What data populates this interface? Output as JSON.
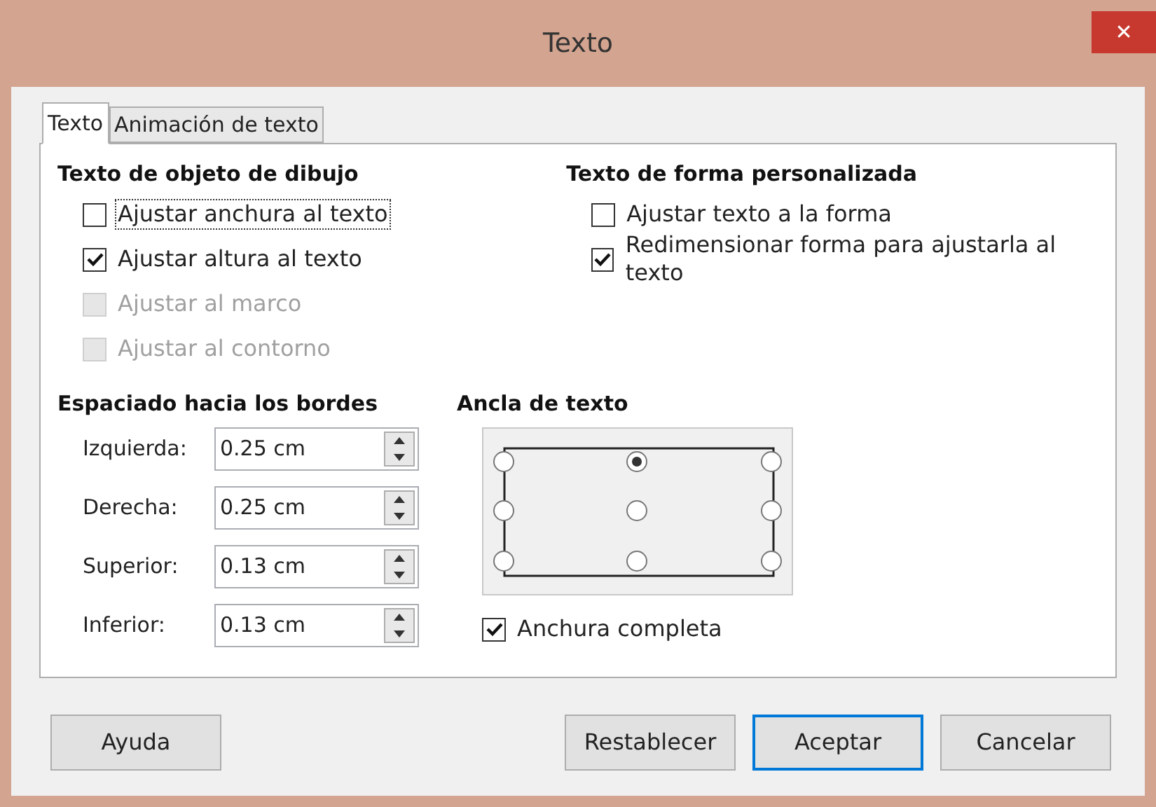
{
  "window": {
    "title": "Texto",
    "close": "✕"
  },
  "tabs": [
    {
      "label": "Texto",
      "selected": true
    },
    {
      "label": "Animación de texto",
      "selected": false
    }
  ],
  "drawing_object_text": {
    "heading": "Texto de objeto de dibujo",
    "options": [
      {
        "label": "Ajustar anchura al texto",
        "checked": false,
        "disabled": false,
        "focused": true
      },
      {
        "label": "Ajustar altura al texto",
        "checked": true,
        "disabled": false,
        "focused": false
      },
      {
        "label": "Ajustar al marco",
        "checked": false,
        "disabled": true,
        "focused": false
      },
      {
        "label": "Ajustar al contorno",
        "checked": false,
        "disabled": true,
        "focused": false
      }
    ]
  },
  "custom_shape_text": {
    "heading": "Texto de forma personalizada",
    "options": [
      {
        "label": "Ajustar texto a la forma",
        "checked": false,
        "disabled": false,
        "focused": false
      },
      {
        "label": "Redimensionar forma para ajustarla al texto",
        "checked": true,
        "disabled": false,
        "focused": false
      }
    ]
  },
  "spacing": {
    "heading": "Espaciado hacia los bordes",
    "fields": [
      {
        "label": "Izquierda:",
        "value": "0.25 cm"
      },
      {
        "label": "Derecha:",
        "value": "0.25 cm"
      },
      {
        "label": "Superior:",
        "value": "0.13 cm"
      },
      {
        "label": "Inferior:",
        "value": "0.13 cm"
      }
    ]
  },
  "text_anchor": {
    "heading": "Ancla de texto",
    "points": [
      {
        "selected": false
      },
      {
        "selected": true
      },
      {
        "selected": false
      },
      {
        "selected": false
      },
      {
        "selected": false
      },
      {
        "selected": false
      },
      {
        "selected": false
      },
      {
        "selected": false
      },
      {
        "selected": false
      }
    ],
    "full_width": {
      "label": "Anchura completa",
      "checked": true,
      "disabled": false,
      "focused": false
    }
  },
  "buttons": [
    {
      "label": "Ayuda",
      "default": false
    },
    {
      "label": "Restablecer",
      "default": false
    },
    {
      "label": "Aceptar",
      "default": true
    },
    {
      "label": "Cancelar",
      "default": false
    }
  ]
}
